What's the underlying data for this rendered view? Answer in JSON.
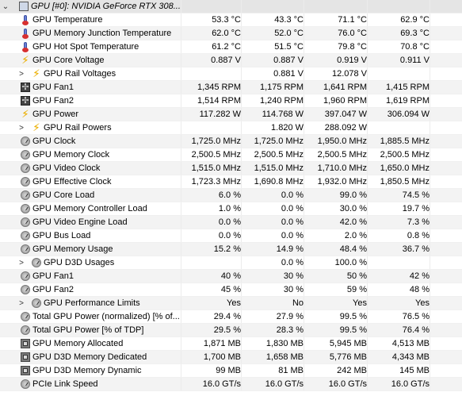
{
  "rows": [
    {
      "key": "gpu",
      "label": "GPU [#0]: NVIDIA GeForce RTX 308...",
      "icon": "monitor-icon",
      "level": 0,
      "expander": "⌄",
      "values": [
        "",
        "",
        "",
        ""
      ],
      "header": true
    },
    {
      "key": "gpu-temp",
      "label": "GPU Temperature",
      "icon": "thermometer-icon",
      "level": 1,
      "values": [
        "53.3 °C",
        "43.3 °C",
        "71.1 °C",
        "62.9 °C"
      ]
    },
    {
      "key": "gpu-mem-junction-temp",
      "label": "GPU Memory Junction Temperature",
      "icon": "thermometer-icon",
      "level": 1,
      "values": [
        "62.0 °C",
        "52.0 °C",
        "76.0 °C",
        "69.3 °C"
      ]
    },
    {
      "key": "gpu-hotspot-temp",
      "label": "GPU Hot Spot Temperature",
      "icon": "thermometer-icon",
      "level": 1,
      "values": [
        "61.2 °C",
        "51.5 °C",
        "79.8 °C",
        "70.8 °C"
      ]
    },
    {
      "key": "gpu-core-voltage",
      "label": "GPU Core Voltage",
      "icon": "bolt-icon",
      "level": 1,
      "values": [
        "0.887 V",
        "0.887 V",
        "0.919 V",
        "0.911 V"
      ]
    },
    {
      "key": "gpu-rail-voltages",
      "label": "GPU Rail Voltages",
      "icon": "bolt-icon",
      "level": 2,
      "expander": ">",
      "values": [
        "",
        "0.881 V",
        "12.078 V",
        ""
      ]
    },
    {
      "key": "gpu-fan1-rpm",
      "label": "GPU Fan1",
      "icon": "fan-icon",
      "level": 1,
      "values": [
        "1,345 RPM",
        "1,175 RPM",
        "1,641 RPM",
        "1,415 RPM"
      ]
    },
    {
      "key": "gpu-fan2-rpm",
      "label": "GPU Fan2",
      "icon": "fan-icon",
      "level": 1,
      "values": [
        "1,514 RPM",
        "1,240 RPM",
        "1,960 RPM",
        "1,619 RPM"
      ]
    },
    {
      "key": "gpu-power",
      "label": "GPU Power",
      "icon": "bolt-icon",
      "level": 1,
      "values": [
        "117.282 W",
        "114.768 W",
        "397.047 W",
        "306.094 W"
      ]
    },
    {
      "key": "gpu-rail-powers",
      "label": "GPU Rail Powers",
      "icon": "bolt-icon",
      "level": 2,
      "expander": ">",
      "values": [
        "",
        "1.820 W",
        "288.092 W",
        ""
      ]
    },
    {
      "key": "gpu-clock",
      "label": "GPU Clock",
      "icon": "gauge-icon",
      "level": 1,
      "values": [
        "1,725.0 MHz",
        "1,725.0 MHz",
        "1,950.0 MHz",
        "1,885.5 MHz"
      ]
    },
    {
      "key": "gpu-memory-clock",
      "label": "GPU Memory Clock",
      "icon": "gauge-icon",
      "level": 1,
      "values": [
        "2,500.5 MHz",
        "2,500.5 MHz",
        "2,500.5 MHz",
        "2,500.5 MHz"
      ]
    },
    {
      "key": "gpu-video-clock",
      "label": "GPU Video Clock",
      "icon": "gauge-icon",
      "level": 1,
      "values": [
        "1,515.0 MHz",
        "1,515.0 MHz",
        "1,710.0 MHz",
        "1,650.0 MHz"
      ]
    },
    {
      "key": "gpu-effective-clock",
      "label": "GPU Effective Clock",
      "icon": "gauge-icon",
      "level": 1,
      "values": [
        "1,723.3 MHz",
        "1,690.8 MHz",
        "1,932.0 MHz",
        "1,850.5 MHz"
      ]
    },
    {
      "key": "gpu-core-load",
      "label": "GPU Core Load",
      "icon": "gauge-icon",
      "level": 1,
      "values": [
        "6.0 %",
        "0.0 %",
        "99.0 %",
        "74.5 %"
      ]
    },
    {
      "key": "gpu-mem-controller-load",
      "label": "GPU Memory Controller Load",
      "icon": "gauge-icon",
      "level": 1,
      "values": [
        "1.0 %",
        "0.0 %",
        "30.0 %",
        "19.7 %"
      ]
    },
    {
      "key": "gpu-video-engine-load",
      "label": "GPU Video Engine Load",
      "icon": "gauge-icon",
      "level": 1,
      "values": [
        "0.0 %",
        "0.0 %",
        "42.0 %",
        "7.3 %"
      ]
    },
    {
      "key": "gpu-bus-load",
      "label": "GPU Bus Load",
      "icon": "gauge-icon",
      "level": 1,
      "values": [
        "0.0 %",
        "0.0 %",
        "2.0 %",
        "0.8 %"
      ]
    },
    {
      "key": "gpu-memory-usage",
      "label": "GPU Memory Usage",
      "icon": "gauge-icon",
      "level": 1,
      "values": [
        "15.2 %",
        "14.9 %",
        "48.4 %",
        "36.7 %"
      ]
    },
    {
      "key": "gpu-d3d-usages",
      "label": "GPU D3D Usages",
      "icon": "gauge-icon",
      "level": 2,
      "expander": ">",
      "values": [
        "",
        "0.0 %",
        "100.0 %",
        ""
      ]
    },
    {
      "key": "gpu-fan1-pct",
      "label": "GPU Fan1",
      "icon": "gauge-icon",
      "level": 1,
      "values": [
        "40 %",
        "30 %",
        "50 %",
        "42 %"
      ]
    },
    {
      "key": "gpu-fan2-pct",
      "label": "GPU Fan2",
      "icon": "gauge-icon",
      "level": 1,
      "values": [
        "45 %",
        "30 %",
        "59 %",
        "48 %"
      ]
    },
    {
      "key": "gpu-performance-limits",
      "label": "GPU Performance Limits",
      "icon": "gauge-icon",
      "level": 2,
      "expander": ">",
      "values": [
        "Yes",
        "No",
        "Yes",
        "Yes"
      ]
    },
    {
      "key": "total-gpu-power-normalized",
      "label": "Total GPU Power (normalized) [% of...",
      "icon": "gauge-icon",
      "level": 1,
      "values": [
        "29.4 %",
        "27.9 %",
        "99.5 %",
        "76.5 %"
      ]
    },
    {
      "key": "total-gpu-power-tdp",
      "label": "Total GPU Power [% of TDP]",
      "icon": "gauge-icon",
      "level": 1,
      "values": [
        "29.5 %",
        "28.3 %",
        "99.5 %",
        "76.4 %"
      ]
    },
    {
      "key": "gpu-memory-allocated",
      "label": "GPU Memory Allocated",
      "icon": "chip-icon",
      "level": 1,
      "values": [
        "1,871 MB",
        "1,830 MB",
        "5,945 MB",
        "4,513 MB"
      ]
    },
    {
      "key": "gpu-d3d-memory-dedicated",
      "label": "GPU D3D Memory Dedicated",
      "icon": "chip-icon",
      "level": 1,
      "values": [
        "1,700 MB",
        "1,658 MB",
        "5,776 MB",
        "4,343 MB"
      ]
    },
    {
      "key": "gpu-d3d-memory-dynamic",
      "label": "GPU D3D Memory Dynamic",
      "icon": "chip-icon",
      "level": 1,
      "values": [
        "99 MB",
        "81 MB",
        "242 MB",
        "145 MB"
      ]
    },
    {
      "key": "pcie-link-speed",
      "label": "PCIe Link Speed",
      "icon": "gauge-icon",
      "level": 1,
      "values": [
        "16.0 GT/s",
        "16.0 GT/s",
        "16.0 GT/s",
        "16.0 GT/s"
      ]
    }
  ]
}
